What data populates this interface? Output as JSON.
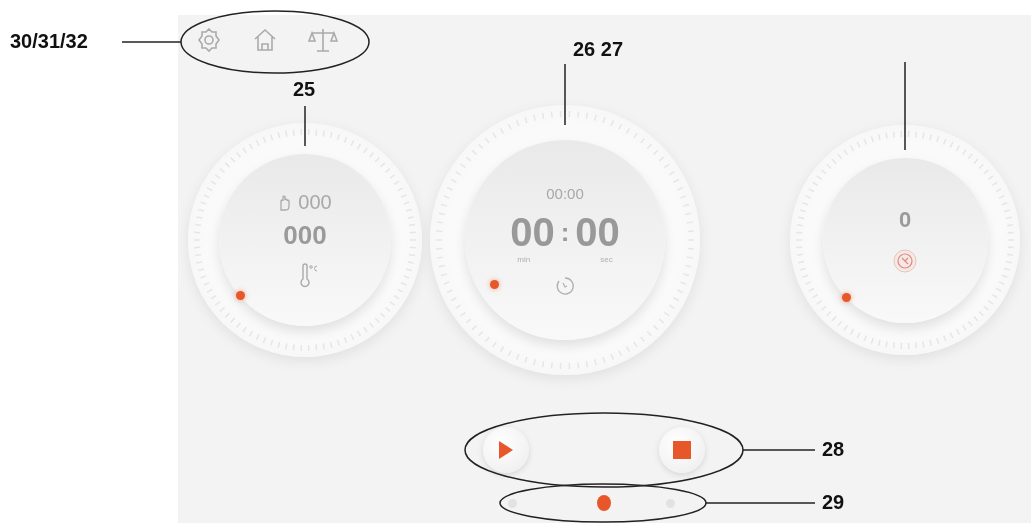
{
  "toolbar": {
    "callout": "30/31/32"
  },
  "dials": [
    {
      "kind": "temperature",
      "callout": "25",
      "speed": "000",
      "value": "000"
    },
    {
      "kind": "timer",
      "callout": "26 27",
      "preset": "00:00",
      "minutes": "00",
      "separator": ":",
      "seconds": "00",
      "min_label": "min",
      "sec_label": "sec"
    },
    {
      "kind": "weight",
      "value": "0"
    }
  ],
  "controls": {
    "callout": "28"
  },
  "pager": {
    "callout": "29",
    "pages": [
      {
        "selected": false
      },
      {
        "selected": true
      },
      {
        "selected": false
      }
    ]
  }
}
